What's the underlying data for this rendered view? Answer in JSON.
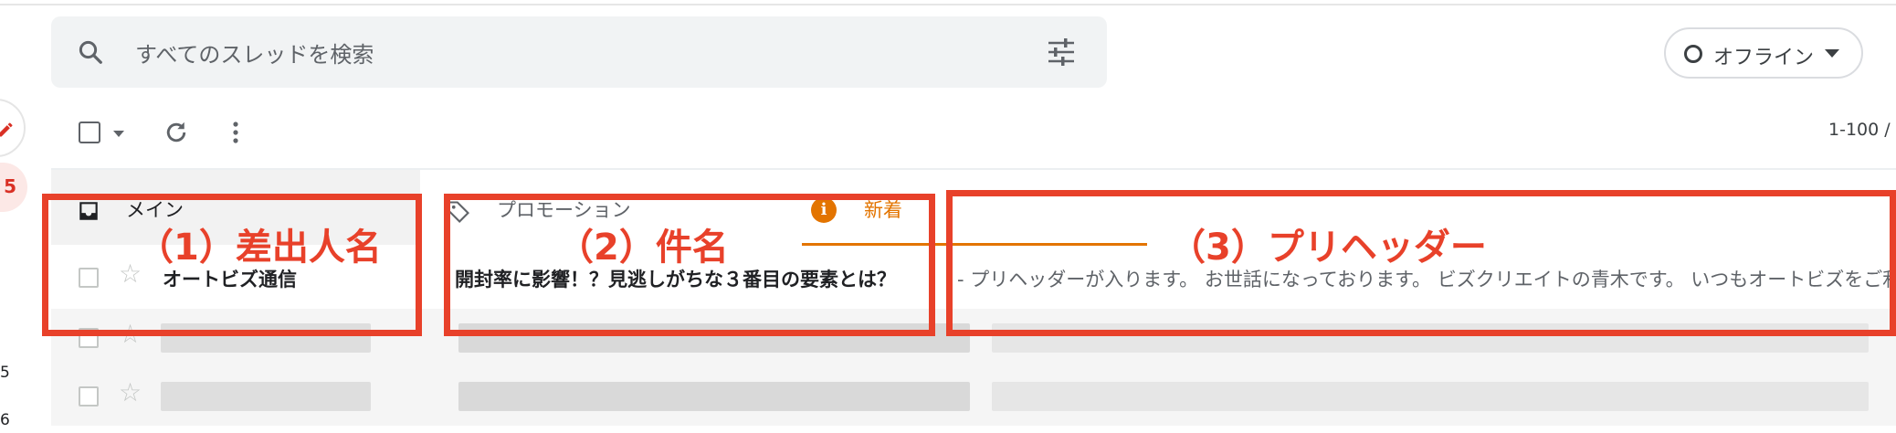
{
  "search": {
    "placeholder": "すべてのスレッドを検索"
  },
  "status": {
    "offline_label": "オフライン"
  },
  "toolbar": {
    "pager": "1-100 /"
  },
  "left_rail": {
    "badge": "5",
    "counts": [
      "5",
      "6"
    ]
  },
  "tabs": [
    {
      "label": "メイン",
      "icon": "inbox-icon"
    },
    {
      "label": "プロモーション",
      "icon": "tag-icon",
      "new_label": "新着"
    }
  ],
  "emails": [
    {
      "sender": "オートビズ通信",
      "subject": "開封率に影響！？見逃しがちな３番目の要素とは？",
      "snippet": "- プリヘッダーが入ります。 お世話になっております。 ビズクリエイトの青木です。 いつもオートビズをご利用いただきありがとうございます。"
    }
  ],
  "annotations": {
    "sender": "（1）差出人名",
    "subject": "（2）件名",
    "preheader": "（3）プリヘッダー"
  },
  "colors": {
    "annotation": "#e8412a",
    "promo_accent": "#e37400",
    "search_bg": "#f1f3f4"
  }
}
